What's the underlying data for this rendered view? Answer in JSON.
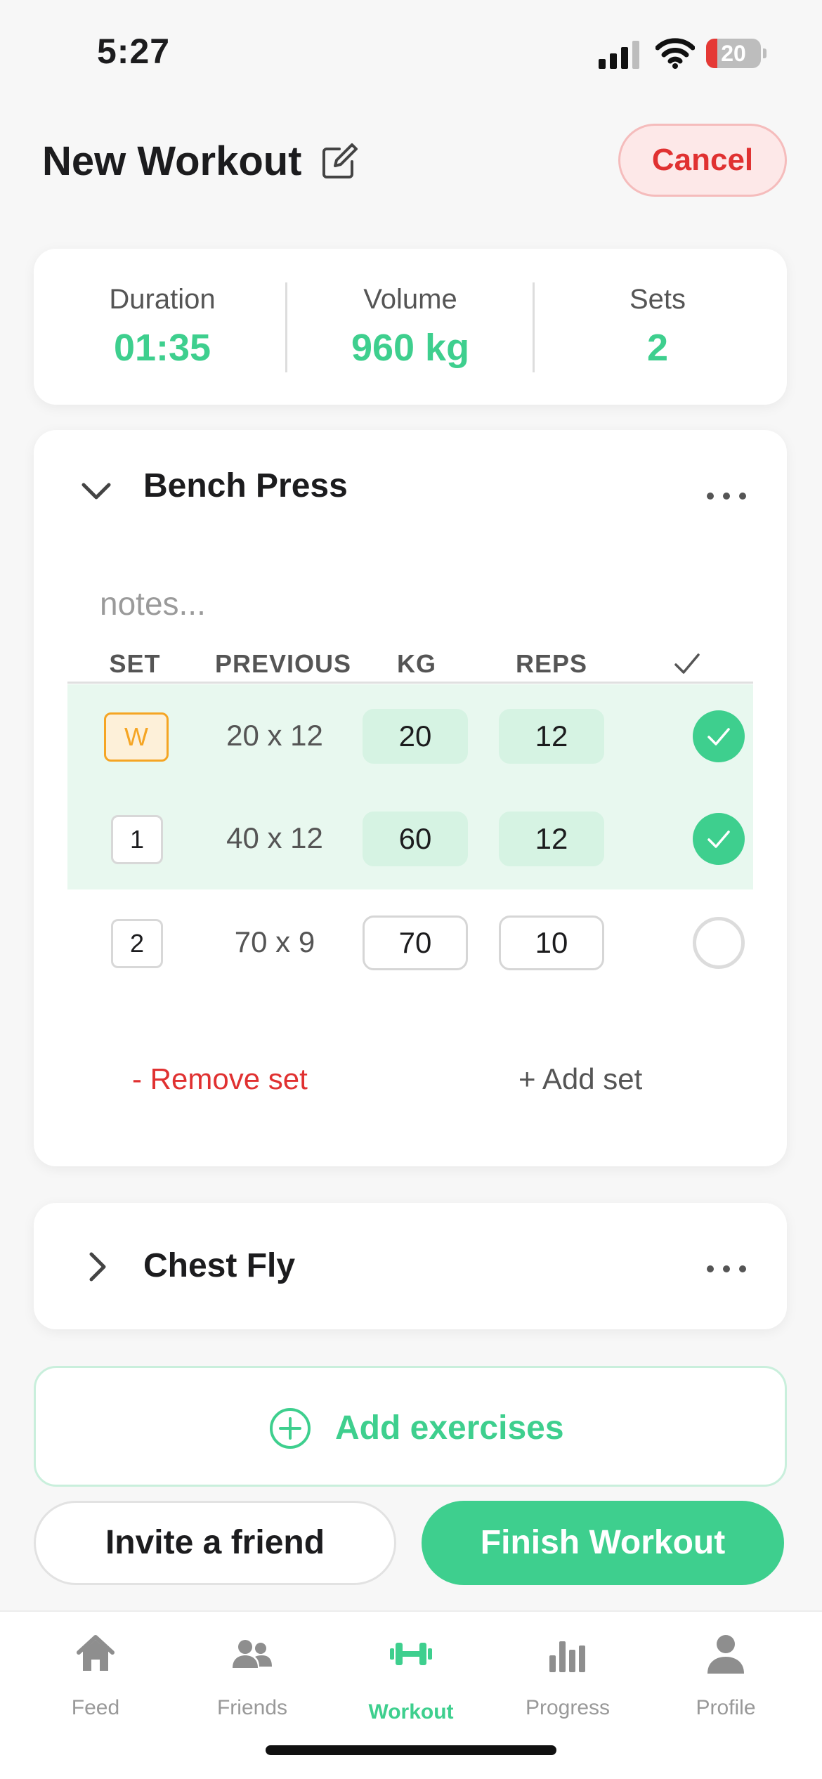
{
  "status_bar": {
    "time": "5:27",
    "battery": "20",
    "battery_level": 0.2
  },
  "header": {
    "title": "New Workout",
    "cancel_label": "Cancel"
  },
  "stats": [
    {
      "label": "Duration",
      "value": "01:35"
    },
    {
      "label": "Volume",
      "value": "960 kg"
    },
    {
      "label": "Sets",
      "value": "2"
    }
  ],
  "exercises": [
    {
      "name": "Bench Press",
      "expanded": true,
      "notes_placeholder": "notes...",
      "columns": [
        "SET",
        "PREVIOUS",
        "KG",
        "REPS"
      ],
      "sets": [
        {
          "set": "W",
          "previous": "20 x 12",
          "kg": "20",
          "reps": "12",
          "done": true
        },
        {
          "set": "1",
          "previous": "40 x 12",
          "kg": "60",
          "reps": "12",
          "done": true
        },
        {
          "set": "2",
          "previous": "70 x 9",
          "kg": "70",
          "reps": "10",
          "done": false
        }
      ],
      "remove_set_label": "- Remove set",
      "add_set_label": "+ Add set"
    },
    {
      "name": "Chest Fly",
      "expanded": false
    }
  ],
  "actions": {
    "add_exercises_label": "Add exercises",
    "invite_label": "Invite a friend",
    "finish_label": "Finish Workout"
  },
  "tab_bar": {
    "items": [
      {
        "label": "Feed",
        "icon": "home-icon"
      },
      {
        "label": "Friends",
        "icon": "friends-icon"
      },
      {
        "label": "Workout",
        "icon": "dumbbell-icon",
        "active": true
      },
      {
        "label": "Progress",
        "icon": "bar-chart-icon"
      },
      {
        "label": "Profile",
        "icon": "person-icon"
      }
    ]
  },
  "colors": {
    "accent": "#3ecf8e",
    "danger": "#e03131",
    "warmup": "#f5a524",
    "done_row": "#e8f8ef"
  }
}
